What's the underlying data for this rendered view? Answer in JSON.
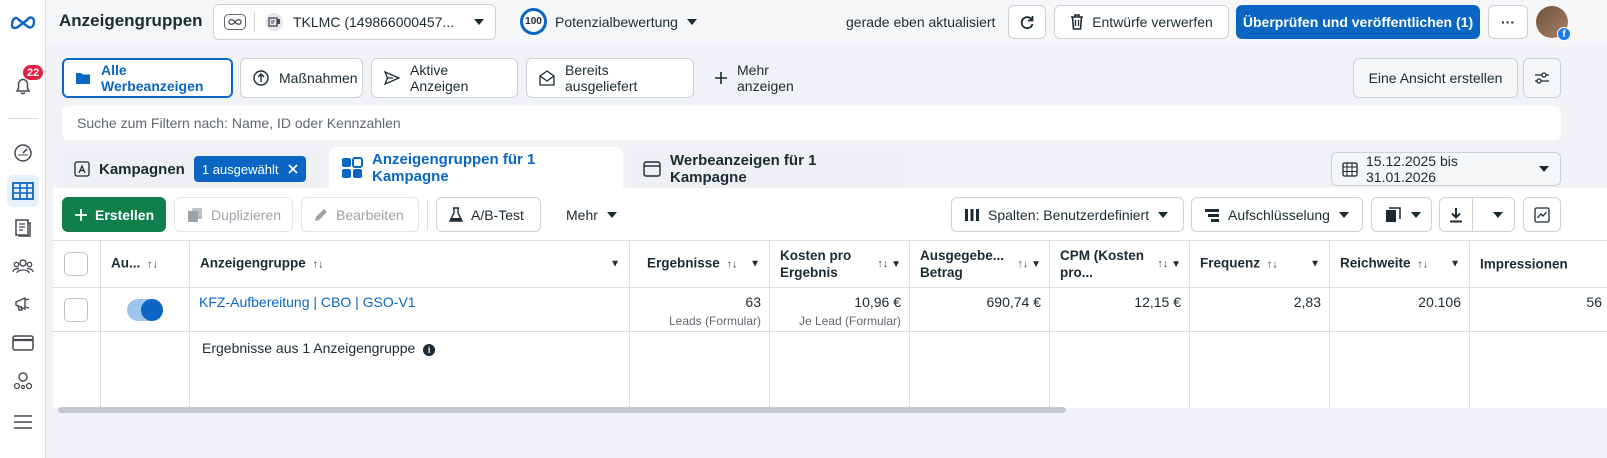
{
  "rail": {
    "notification_count": "22"
  },
  "header": {
    "title": "Anzeigengruppen",
    "account_name": "TKLMC (149866000457...",
    "score_value": "100",
    "score_label": "Potenzialbewertung",
    "updated_text": "gerade eben aktualisiert",
    "discard_label": "Entwürfe verwerfen",
    "publish_label": "Überprüfen und veröffentlichen (1)",
    "more_label": "···"
  },
  "views": {
    "items": [
      {
        "label": "Alle Werbeanzeigen"
      },
      {
        "label": "Maßnahmen"
      },
      {
        "label": "Aktive Anzeigen"
      },
      {
        "label": "Bereits ausgeliefert"
      }
    ],
    "more_label": "Mehr anzeigen",
    "create_view_label": "Eine Ansicht erstellen"
  },
  "search": {
    "placeholder": "Suche zum Filtern nach: Name, ID oder Kennzahlen"
  },
  "level_tabs": {
    "campaigns_label": "Kampagnen",
    "selected_chip": "1 ausgewählt",
    "adsets_label": "Anzeigengruppen für 1 Kampagne",
    "ads_label": "Werbeanzeigen für 1 Kampagne"
  },
  "date_range": "15.12.2025 bis 31.01.2026",
  "toolbar": {
    "create_label": "Erstellen",
    "duplicate_label": "Duplizieren",
    "edit_label": "Bearbeiten",
    "abtest_label": "A/B-Test",
    "more_label": "Mehr",
    "columns_label": "Spalten: Benutzerdefiniert",
    "breakdown_label": "Aufschlüsselung"
  },
  "table": {
    "headers": {
      "delivery": "Au...",
      "name": "Anzeigengruppe",
      "results": "Ergebnisse",
      "cost_per_result_1": "Kosten pro",
      "cost_per_result_2": "Ergebnis",
      "spend_1": "Ausgegebe...",
      "spend_2": "Betrag",
      "cpm_1": "CPM (Kosten",
      "cpm_2": "pro...",
      "frequency": "Frequenz",
      "reach": "Reichweite",
      "impressions": "Impressionen"
    },
    "row": {
      "name": "KFZ-Aufbereitung | CBO | GSO-V1",
      "results": "63",
      "results_sub": "Leads (Formular)",
      "cost_per_result": "10,96 €",
      "cost_per_result_sub": "Je Lead (Formular)",
      "spend": "690,74 €",
      "cpm": "12,15 €",
      "frequency": "2,83",
      "reach": "20.106",
      "impressions": "56",
      "delivery_on": true
    },
    "summary": "Ergebnisse aus 1 Anzeigengruppe",
    "info_icon": "i"
  }
}
